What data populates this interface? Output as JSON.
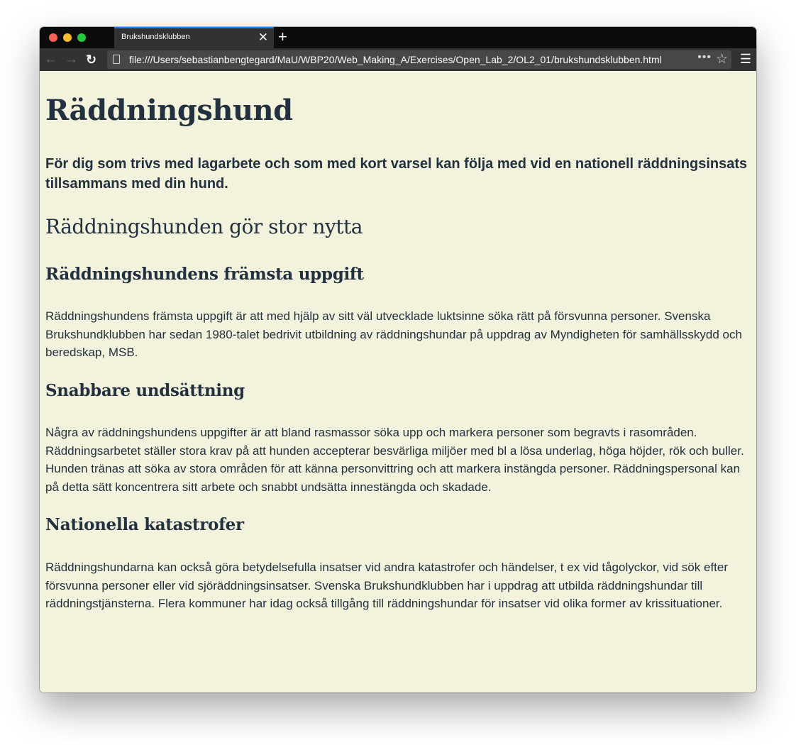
{
  "browser": {
    "tab_title": "Brukshundsklubben",
    "tab_close_glyph": "✕",
    "new_tab_glyph": "+",
    "url": "file:///Users/sebastianbengtegard/MaU/WBP20/Web_Making_A/Exercises/Open_Lab_2/OL2_01/brukshundsklubben.html",
    "back_glyph": "←",
    "forward_glyph": "→",
    "reload_glyph": "↻",
    "more_glyph": "•••",
    "bookmark_glyph": "☆",
    "menu_glyph": "☰"
  },
  "page": {
    "title": "Räddningshund",
    "lead": "För dig som trivs med lagarbete och som med kort varsel kan följa med vid en nationell räddningsinsats tillsammans med din hund.",
    "subtitle": "Räddningshunden gör stor nytta",
    "sections": [
      {
        "heading": "Räddningshundens främsta uppgift",
        "text": "Räddningshundens främsta uppgift är att med hjälp av sitt väl utvecklade luktsinne söka rätt på försvunna personer. Svenska Brukshundklubben har sedan 1980-talet bedrivit utbildning av räddningshundar på uppdrag av Myndigheten för samhällsskydd och beredskap, MSB."
      },
      {
        "heading": "Snabbare undsättning",
        "text": "Några av räddningshundens uppgifter är att bland rasmassor söka upp och markera personer som begravts i rasområden. Räddningsarbetet ställer stora krav på att hunden accepterar besvärliga miljöer med bl a lösa underlag, höga höjder, rök och buller. Hunden tränas att söka av stora områden för att känna personvittring och att markera instängda personer. Räddningspersonal kan på detta sätt koncentrera sitt arbete och snabbt undsätta innestängda och skadade."
      },
      {
        "heading": "Nationella katastrofer",
        "text": "Räddningshundarna kan också göra betydelsefulla insatser vid andra katastrofer och händelser, t ex vid tågolyckor, vid sök efter försvunna personer eller vid sjöräddningsinsatser. Svenska Brukshundklubben har i uppdrag att utbilda räddningshundar till räddningstjänsterna. Flera kommuner har idag också tillgång till räddningshundar för insatser vid olika former av krissituationer."
      }
    ]
  },
  "colors": {
    "page_background": "#f3f3dd",
    "text": "#22313f",
    "chrome_dark": "#0c0c0d",
    "chrome_toolbar": "#323234",
    "tab_accent": "#0a84ff"
  }
}
